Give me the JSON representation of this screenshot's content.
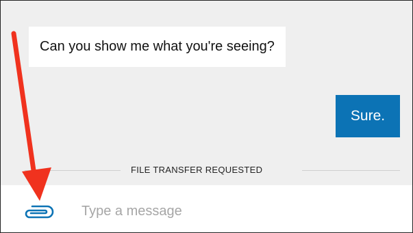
{
  "conversation": {
    "incoming_message": "Can you show me what you're seeing?",
    "outgoing_message": "Sure."
  },
  "system_event": {
    "label": "FILE TRANSFER REQUESTED"
  },
  "composer": {
    "attach_icon": "paperclip-icon",
    "input_value": "",
    "input_placeholder": "Type a message"
  },
  "annotation": {
    "arrow_color": "#f0321e"
  },
  "colors": {
    "accent": "#0c73b5",
    "chat_background": "#efefef"
  }
}
